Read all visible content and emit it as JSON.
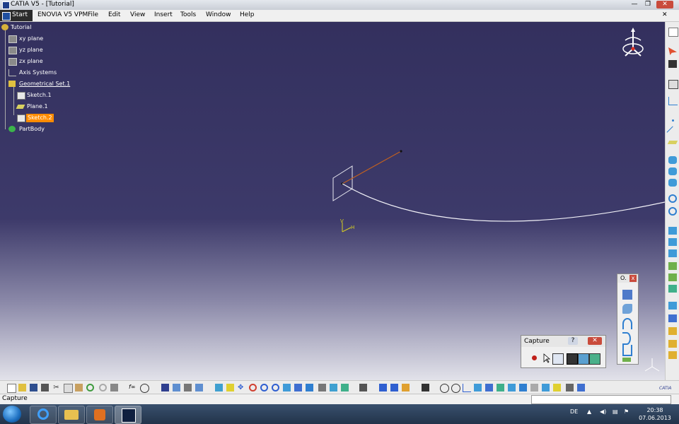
{
  "window": {
    "title": "CATIA V5 - [Tutorial]",
    "controls": {
      "minimize": "—",
      "restore": "❐",
      "close": "✕"
    }
  },
  "menu": {
    "start": "Start",
    "items": [
      "ENOVIA V5 VPM",
      "File",
      "Edit",
      "View",
      "Insert",
      "Tools",
      "Window",
      "Help"
    ],
    "mdi_close": "✕"
  },
  "tree": {
    "root": "Tutorial",
    "items": [
      {
        "label": "xy plane",
        "icon": "plane-icon"
      },
      {
        "label": "yz plane",
        "icon": "plane-icon"
      },
      {
        "label": "zx plane",
        "icon": "plane-icon"
      },
      {
        "label": "Axis Systems",
        "icon": "axis-systems-icon"
      },
      {
        "label": "Geometrical Set.1",
        "icon": "geometrical-set-icon"
      },
      {
        "label": "Sketch.1",
        "icon": "sketch-icon"
      },
      {
        "label": "Plane.1",
        "icon": "plane-feature-icon"
      },
      {
        "label": "Sketch.2",
        "icon": "sketch-icon",
        "selected": true
      },
      {
        "label": "PartBody",
        "icon": "partbody-icon"
      }
    ]
  },
  "viewport": {
    "axis_h_label": "H",
    "axis_v_label": "V",
    "colors": {
      "bg_top": "#33305e",
      "bg_bottom": "#e2e2ea",
      "selected": "#ff8c00",
      "curve": "#ffffff",
      "line": "#c06020"
    }
  },
  "capture_panel": {
    "title": "Capture",
    "help": "?",
    "close": "✕",
    "tools": [
      "record-icon",
      "select-icon",
      "options-icon",
      "capture-icon",
      "album-icon",
      "image-icon"
    ]
  },
  "tools_panel": {
    "title": "O.",
    "close": "x"
  },
  "status": {
    "text": "Capture"
  },
  "taskbar": {
    "apps": [
      "internet-explorer-icon",
      "explorer-icon",
      "media-player-icon",
      "catia-icon"
    ],
    "lang": "DE",
    "time": "20:38",
    "date": "07.06.2013"
  },
  "brand": {
    "logo_text": "CATIA"
  }
}
